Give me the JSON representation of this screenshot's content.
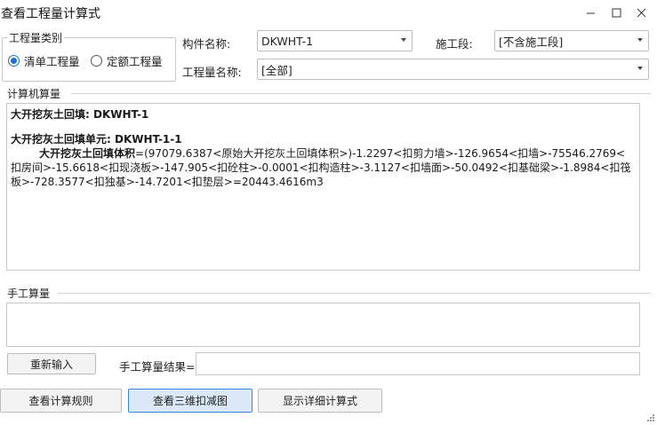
{
  "window": {
    "title": "查看工程量计算式"
  },
  "quantity_type": {
    "legend": "工程量类别",
    "options": [
      "清单工程量",
      "定额工程量"
    ],
    "selected": "清单工程量"
  },
  "filters": {
    "component_label": "构件名称:",
    "component_value": "DKWHT-1",
    "stage_label": "施工段:",
    "stage_value": "[不含施工段]",
    "quantity_name_label": "工程量名称:",
    "quantity_name_value": "[全部]"
  },
  "computer_calc": {
    "legend": "计算机算量",
    "line1": "大开挖灰土回填: DKWHT-1",
    "line2": "大开挖灰土回填单元: DKWHT-1-1",
    "expr_name": "大开挖灰土回填体积",
    "expr_body": "=(97079.6387<原始大开挖灰土回填体积>)-1.2297<扣剪力墙>-126.9654<扣墙>-75546.2769<扣房间>-15.6618<扣现浇板>-147.905<扣砼柱>-0.0001<扣构造柱>-3.1127<扣墙面>-50.0492<扣基础梁>-1.8984<扣筏板>-728.3577<扣独基>-14.7201<扣垫层>=20443.4616m3"
  },
  "manual_calc": {
    "legend": "手工算量",
    "reenter_label": "重新输入",
    "result_label": "手工算量结果="
  },
  "footer": {
    "view_rules": "查看计算规则",
    "view_3d": "查看三维扣减图",
    "show_detail": "显示详细计算式"
  }
}
